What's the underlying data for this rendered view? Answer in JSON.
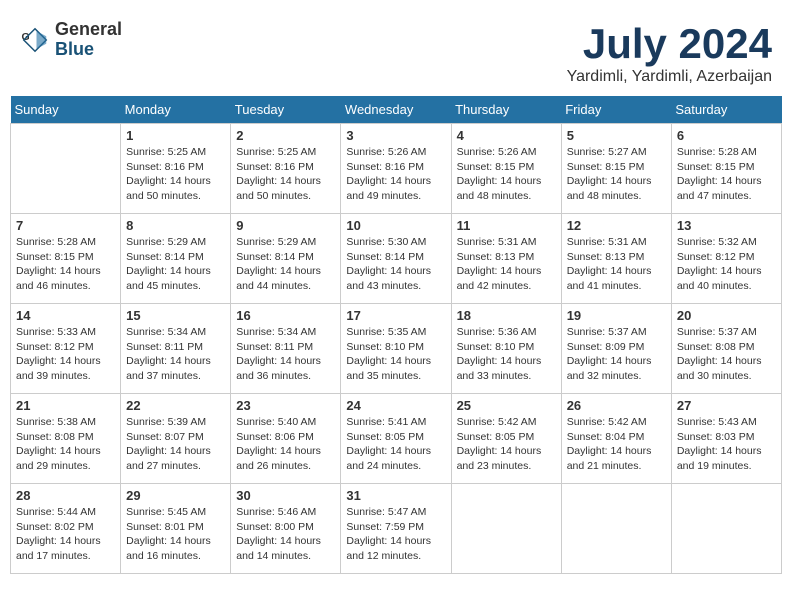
{
  "logo": {
    "general": "General",
    "blue": "Blue"
  },
  "title": "July 2024",
  "location": "Yardimli, Yardimli, Azerbaijan",
  "days_of_week": [
    "Sunday",
    "Monday",
    "Tuesday",
    "Wednesday",
    "Thursday",
    "Friday",
    "Saturday"
  ],
  "weeks": [
    [
      {
        "day": "",
        "info": ""
      },
      {
        "day": "1",
        "info": "Sunrise: 5:25 AM\nSunset: 8:16 PM\nDaylight: 14 hours\nand 50 minutes."
      },
      {
        "day": "2",
        "info": "Sunrise: 5:25 AM\nSunset: 8:16 PM\nDaylight: 14 hours\nand 50 minutes."
      },
      {
        "day": "3",
        "info": "Sunrise: 5:26 AM\nSunset: 8:16 PM\nDaylight: 14 hours\nand 49 minutes."
      },
      {
        "day": "4",
        "info": "Sunrise: 5:26 AM\nSunset: 8:15 PM\nDaylight: 14 hours\nand 48 minutes."
      },
      {
        "day": "5",
        "info": "Sunrise: 5:27 AM\nSunset: 8:15 PM\nDaylight: 14 hours\nand 48 minutes."
      },
      {
        "day": "6",
        "info": "Sunrise: 5:28 AM\nSunset: 8:15 PM\nDaylight: 14 hours\nand 47 minutes."
      }
    ],
    [
      {
        "day": "7",
        "info": "Sunrise: 5:28 AM\nSunset: 8:15 PM\nDaylight: 14 hours\nand 46 minutes."
      },
      {
        "day": "8",
        "info": "Sunrise: 5:29 AM\nSunset: 8:14 PM\nDaylight: 14 hours\nand 45 minutes."
      },
      {
        "day": "9",
        "info": "Sunrise: 5:29 AM\nSunset: 8:14 PM\nDaylight: 14 hours\nand 44 minutes."
      },
      {
        "day": "10",
        "info": "Sunrise: 5:30 AM\nSunset: 8:14 PM\nDaylight: 14 hours\nand 43 minutes."
      },
      {
        "day": "11",
        "info": "Sunrise: 5:31 AM\nSunset: 8:13 PM\nDaylight: 14 hours\nand 42 minutes."
      },
      {
        "day": "12",
        "info": "Sunrise: 5:31 AM\nSunset: 8:13 PM\nDaylight: 14 hours\nand 41 minutes."
      },
      {
        "day": "13",
        "info": "Sunrise: 5:32 AM\nSunset: 8:12 PM\nDaylight: 14 hours\nand 40 minutes."
      }
    ],
    [
      {
        "day": "14",
        "info": "Sunrise: 5:33 AM\nSunset: 8:12 PM\nDaylight: 14 hours\nand 39 minutes."
      },
      {
        "day": "15",
        "info": "Sunrise: 5:34 AM\nSunset: 8:11 PM\nDaylight: 14 hours\nand 37 minutes."
      },
      {
        "day": "16",
        "info": "Sunrise: 5:34 AM\nSunset: 8:11 PM\nDaylight: 14 hours\nand 36 minutes."
      },
      {
        "day": "17",
        "info": "Sunrise: 5:35 AM\nSunset: 8:10 PM\nDaylight: 14 hours\nand 35 minutes."
      },
      {
        "day": "18",
        "info": "Sunrise: 5:36 AM\nSunset: 8:10 PM\nDaylight: 14 hours\nand 33 minutes."
      },
      {
        "day": "19",
        "info": "Sunrise: 5:37 AM\nSunset: 8:09 PM\nDaylight: 14 hours\nand 32 minutes."
      },
      {
        "day": "20",
        "info": "Sunrise: 5:37 AM\nSunset: 8:08 PM\nDaylight: 14 hours\nand 30 minutes."
      }
    ],
    [
      {
        "day": "21",
        "info": "Sunrise: 5:38 AM\nSunset: 8:08 PM\nDaylight: 14 hours\nand 29 minutes."
      },
      {
        "day": "22",
        "info": "Sunrise: 5:39 AM\nSunset: 8:07 PM\nDaylight: 14 hours\nand 27 minutes."
      },
      {
        "day": "23",
        "info": "Sunrise: 5:40 AM\nSunset: 8:06 PM\nDaylight: 14 hours\nand 26 minutes."
      },
      {
        "day": "24",
        "info": "Sunrise: 5:41 AM\nSunset: 8:05 PM\nDaylight: 14 hours\nand 24 minutes."
      },
      {
        "day": "25",
        "info": "Sunrise: 5:42 AM\nSunset: 8:05 PM\nDaylight: 14 hours\nand 23 minutes."
      },
      {
        "day": "26",
        "info": "Sunrise: 5:42 AM\nSunset: 8:04 PM\nDaylight: 14 hours\nand 21 minutes."
      },
      {
        "day": "27",
        "info": "Sunrise: 5:43 AM\nSunset: 8:03 PM\nDaylight: 14 hours\nand 19 minutes."
      }
    ],
    [
      {
        "day": "28",
        "info": "Sunrise: 5:44 AM\nSunset: 8:02 PM\nDaylight: 14 hours\nand 17 minutes."
      },
      {
        "day": "29",
        "info": "Sunrise: 5:45 AM\nSunset: 8:01 PM\nDaylight: 14 hours\nand 16 minutes."
      },
      {
        "day": "30",
        "info": "Sunrise: 5:46 AM\nSunset: 8:00 PM\nDaylight: 14 hours\nand 14 minutes."
      },
      {
        "day": "31",
        "info": "Sunrise: 5:47 AM\nSunset: 7:59 PM\nDaylight: 14 hours\nand 12 minutes."
      },
      {
        "day": "",
        "info": ""
      },
      {
        "day": "",
        "info": ""
      },
      {
        "day": "",
        "info": ""
      }
    ]
  ]
}
